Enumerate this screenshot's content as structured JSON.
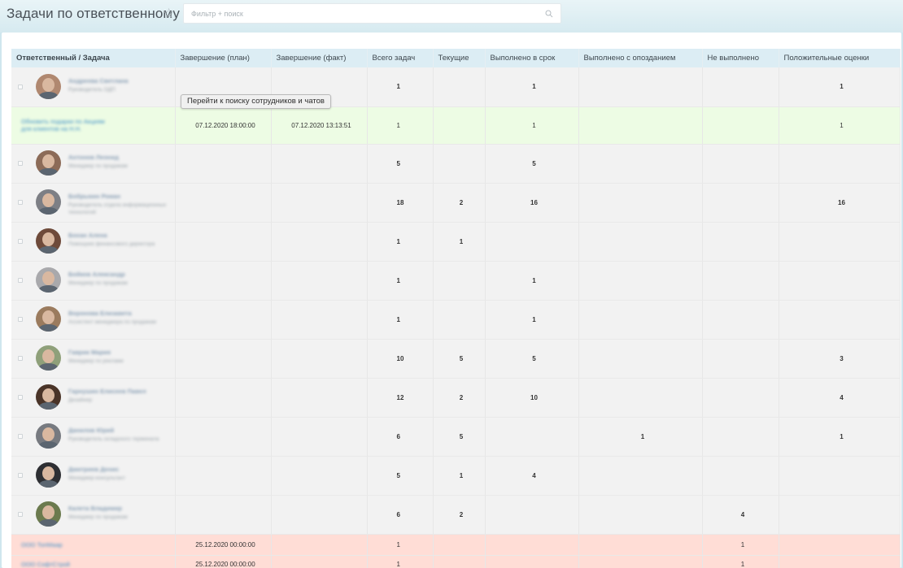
{
  "header": {
    "title": "Задачи по ответственному",
    "search_placeholder": "Фильтр + поиск"
  },
  "columns": [
    "Ответственный / Задача",
    "Завершение (план)",
    "Завершение (факт)",
    "Всего задач",
    "Текущие",
    "Выполнено в срок",
    "Выполнено с опозданием",
    "Не выполнено",
    "Положительные оценки"
  ],
  "tooltip": "Перейти к поиску сотрудников и чатов",
  "rows": [
    {
      "kind": "emp",
      "name": "Андреева Светлана",
      "role": "Руководитель ОДП",
      "avatar": "#b08870",
      "total": "1",
      "current": "",
      "ontime": "1",
      "late": "",
      "failed": "",
      "positive": "1"
    },
    {
      "kind": "task",
      "title": "Обновить подарки по Акциям для клиентов на Н.Н.",
      "plan": "07.12.2020 18:00:00",
      "fact": "07.12.2020 13:13:51",
      "total": "1",
      "current": "",
      "ontime": "1",
      "late": "",
      "failed": "",
      "positive": "1"
    },
    {
      "kind": "emp",
      "name": "Антонов Леонид",
      "role": "Менеджер по продажам",
      "avatar": "#8c6b58",
      "total": "5",
      "current": "",
      "ontime": "5",
      "late": "",
      "failed": "",
      "positive": ""
    },
    {
      "kind": "emp",
      "name": "Бобрыкин Роман",
      "role": "Руководитель отдела информационных технологий",
      "avatar": "#7d7f85",
      "total": "18",
      "current": "2",
      "ontime": "16",
      "late": "",
      "failed": "",
      "positive": "16"
    },
    {
      "kind": "emp",
      "name": "Бохан Алена",
      "role": "Помощник финансового директора",
      "avatar": "#6e4a3a",
      "total": "1",
      "current": "1",
      "ontime": "",
      "late": "",
      "failed": "",
      "positive": ""
    },
    {
      "kind": "emp",
      "name": "Бойков Александр",
      "role": "Менеджер по продажам",
      "avatar": "#a9a9ac",
      "total": "1",
      "current": "",
      "ontime": "1",
      "late": "",
      "failed": "",
      "positive": ""
    },
    {
      "kind": "emp",
      "name": "Воронова Елизавета",
      "role": "Ассистент менеджера по продажам",
      "avatar": "#9b7b5e",
      "total": "1",
      "current": "",
      "ontime": "1",
      "late": "",
      "failed": "",
      "positive": ""
    },
    {
      "kind": "emp",
      "name": "Гаврик Мария",
      "role": "Менеджер по рекламе",
      "avatar": "#8fa07a",
      "total": "10",
      "current": "5",
      "ontime": "5",
      "late": "",
      "failed": "",
      "positive": "3"
    },
    {
      "kind": "emp",
      "name": "Гарнушин Елисеев Павел",
      "role": "Дизайнер",
      "avatar": "#4a3428",
      "total": "12",
      "current": "2",
      "ontime": "10",
      "late": "",
      "failed": "",
      "positive": "4"
    },
    {
      "kind": "emp",
      "name": "Данилов Юрий",
      "role": "Руководитель складского терминала",
      "avatar": "#777a80",
      "total": "6",
      "current": "5",
      "ontime": "",
      "late": "1",
      "failed": "",
      "positive": "1"
    },
    {
      "kind": "emp",
      "name": "Дмитриев Денис",
      "role": "Менеджер-консультант",
      "avatar": "#2e2f33",
      "total": "5",
      "current": "1",
      "ontime": "4",
      "late": "",
      "failed": "",
      "positive": ""
    },
    {
      "kind": "emp",
      "name": "Калета Владимир",
      "role": "Менеджер по продажам",
      "avatar": "#6b7a4e",
      "total": "6",
      "current": "2",
      "ontime": "",
      "late": "",
      "failed": "4",
      "positive": ""
    },
    {
      "kind": "task-red",
      "title": "ООО ТопМаар",
      "plan": "25.12.2020 00:00:00",
      "fact": "",
      "total": "1",
      "current": "",
      "ontime": "",
      "late": "",
      "failed": "1",
      "positive": ""
    },
    {
      "kind": "task-red",
      "title": "ООО СофтСтрой",
      "plan": "25.12.2020 00:00:00",
      "fact": "",
      "total": "1",
      "current": "",
      "ontime": "",
      "late": "",
      "failed": "1",
      "positive": ""
    }
  ],
  "colors": {
    "header_bg": "#dcedf4",
    "employee_row": "#f2f2f2",
    "task_ontime_row": "#edfce4",
    "task_failed_row": "#ffddd6",
    "link": "#3f8fc7"
  },
  "icons": {
    "favorite": "star-icon",
    "search": "search-icon",
    "expand": "expander-icon"
  }
}
